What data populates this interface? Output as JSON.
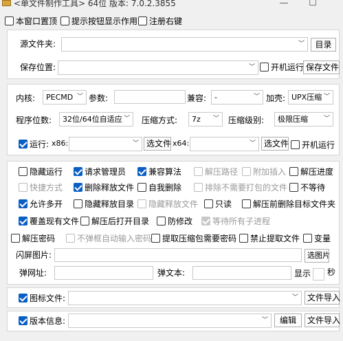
{
  "window": {
    "title": "<单文件制作工具> 64位 版本: 7.0.2.3855",
    "minimize": "—",
    "maximize": "☐"
  },
  "topbar": {
    "always_on_top": "本窗口置顶",
    "show_tooltip": "提示按钮显示作用",
    "register_context": "注册右键"
  },
  "source": {
    "label": "源文件夹:",
    "dir_btn": "目录"
  },
  "save": {
    "label": "保存位置:",
    "startup_label": "开机运行",
    "save_btn": "保存文件"
  },
  "kernel": {
    "label": "内核:",
    "value": "PECMD",
    "params_label": "参数:",
    "compat_label": "兼容:",
    "compat_value": "-",
    "shell_label": "加壳:",
    "shell_value": "UPX压缩"
  },
  "arch": {
    "label": "程序位数:",
    "value": "32位/64位自适应",
    "compress_label": "压缩方式:",
    "compress_value": "7z",
    "level_label": "压缩级别:",
    "level_value": "极限压缩"
  },
  "run": {
    "label": "运行:",
    "x86_label": "x86:",
    "select_btn_1": "选文件",
    "x64_label": "x64:",
    "select_btn_2": "选文件",
    "startup_label": "开机运行"
  },
  "options": {
    "hide_run": "隐藏运行",
    "request_admin": "请求管理员",
    "compat_algo": "兼容算法",
    "extract_path": "解压路径",
    "attach_insert": "附加插入",
    "extract_progress": "解压进度",
    "shortcut": "快捷方式",
    "delete_released": "删除释放文件",
    "self_delete": "自我删除",
    "exclude_unneeded": "排除不需要打包的文件",
    "no_wait": "不等待",
    "allow_multi": "允许多开",
    "hide_release_dir": "隐藏释放目录",
    "hide_release_files": "隐藏释放文件",
    "read_only": "只读",
    "delete_target_before": "解压前删除目标文件夹",
    "overwrite_existing": "覆盖现有文件",
    "open_dir_after": "解压后打开目录",
    "anti_modify": "防修改",
    "wait_all_children": "等待所有子进程",
    "extract_password": "解压密码",
    "no_popup_password": "不弹框自动输入密码",
    "extract_needs_password": "提取压缩包需要密码",
    "forbid_extract": "禁止提取文件",
    "variable": "变量"
  },
  "splash": {
    "label": "闪屏图片:",
    "select_btn": "选图片"
  },
  "popup": {
    "url_label": "弹网址:",
    "text_label": "弹文本:",
    "show_label": "显示",
    "seconds_label": "秒"
  },
  "icon": {
    "label": "图标文件:",
    "import_btn": "文件导入"
  },
  "version": {
    "label": "版本信息:",
    "edit_btn": "编辑",
    "import_btn": "文件导入"
  }
}
